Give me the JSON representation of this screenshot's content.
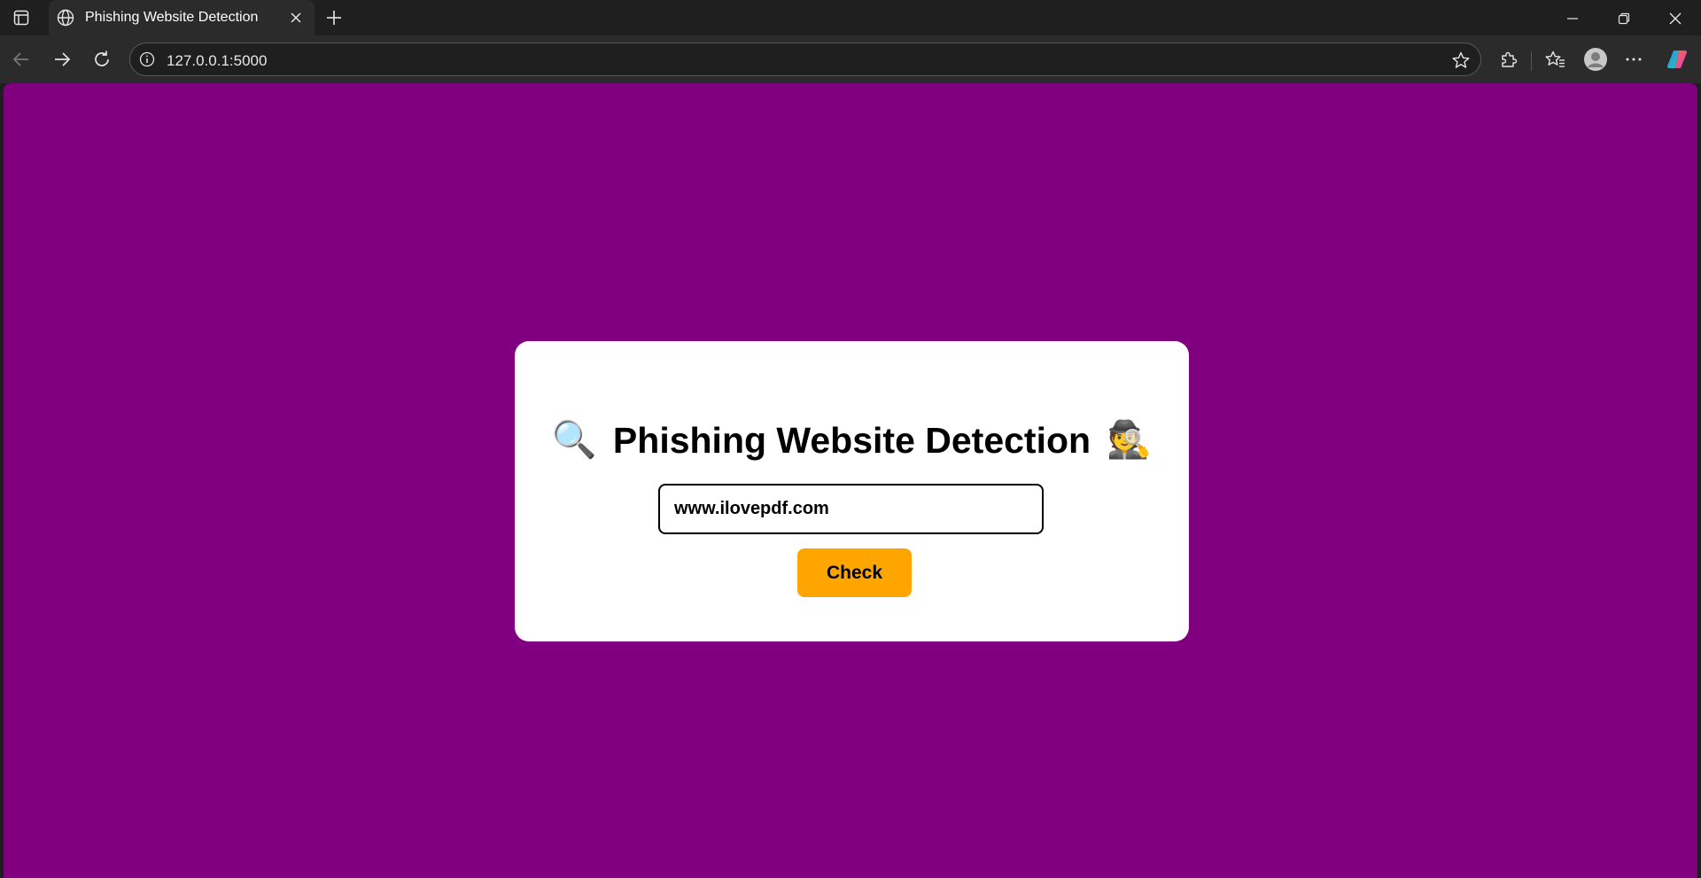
{
  "browser": {
    "tab": {
      "title": "Phishing Website Detection"
    },
    "address_bar": {
      "url": "127.0.0.1:5000"
    },
    "icons": {
      "tab_actions": "tab-actions-icon",
      "favicon": "globe-icon",
      "tab_close": "close-icon",
      "new_tab": "plus-icon",
      "minimize": "minimize-icon",
      "restore": "restore-icon",
      "close_window": "close-icon",
      "back": "back-arrow-icon",
      "forward": "forward-arrow-icon",
      "refresh": "refresh-icon",
      "site_info": "info-icon",
      "favorite": "star-icon",
      "extensions": "puzzle-icon",
      "favorites": "favorites-list-icon",
      "profile": "avatar-icon",
      "menu": "more-dots-icon",
      "copilot": "copilot-icon"
    }
  },
  "page": {
    "background_color": "#800080",
    "card": {
      "heading_left_emoji": "🔍",
      "heading": "Phishing Website Detection",
      "heading_right_emoji": "🕵️",
      "url_input_value": "www.ilovepdf.com",
      "check_button_label": "Check",
      "button_color": "#ffa500"
    }
  }
}
